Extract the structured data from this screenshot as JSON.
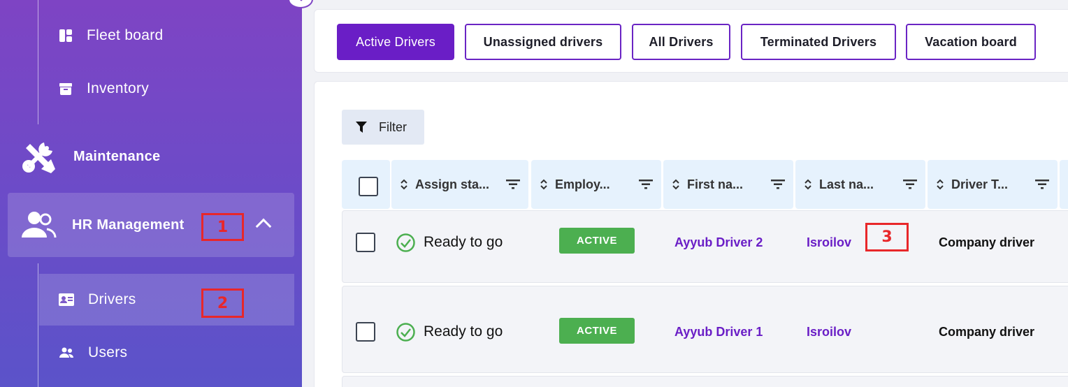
{
  "sidebar": {
    "items": [
      {
        "label": "Fleet board",
        "icon": "dashboard-icon"
      },
      {
        "label": "Inventory",
        "icon": "archive-box-icon"
      },
      {
        "label": "Maintenance",
        "icon": "tools-icon"
      },
      {
        "label": "HR Management",
        "icon": "people-group-icon"
      },
      {
        "label": "Drivers",
        "icon": "id-card-icon"
      },
      {
        "label": "Users",
        "icon": "users-icon"
      }
    ]
  },
  "markers": [
    "1",
    "2",
    "3"
  ],
  "tabs": [
    {
      "label": "Active Drivers",
      "active": true
    },
    {
      "label": "Unassigned drivers"
    },
    {
      "label": "All Drivers"
    },
    {
      "label": "Terminated Drivers"
    },
    {
      "label": "Vacation board"
    }
  ],
  "filter": {
    "label": "Filter"
  },
  "table": {
    "columns": [
      "Assign sta...",
      "Employ...",
      "First na...",
      "Last na...",
      "Driver T..."
    ],
    "rows": [
      {
        "status": "Ready to go",
        "employment": "ACTIVE",
        "first_name": "Ayyub Driver 2",
        "last_name": "Isroilov",
        "driver_type": "Company driver"
      },
      {
        "status": "Ready to go",
        "employment": "ACTIVE",
        "first_name": "Ayyub Driver 1",
        "last_name": "Isroilov",
        "driver_type": "Company driver"
      }
    ]
  },
  "colors": {
    "accent": "#6a1ec6",
    "badge_green": "#4caf50",
    "marker_red": "#e8272a",
    "check_green": "#4caf50"
  }
}
